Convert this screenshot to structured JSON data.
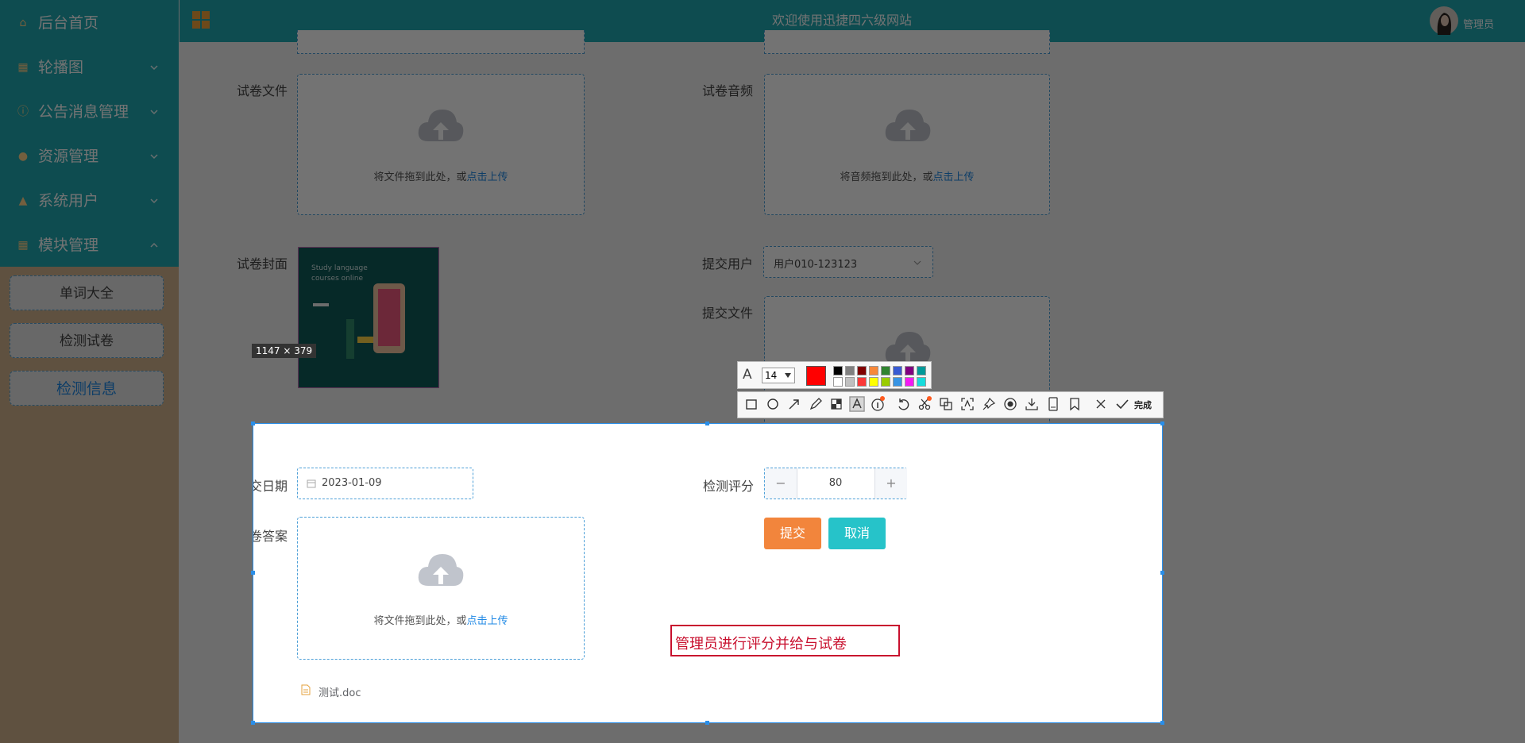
{
  "sidebar": {
    "menu": [
      {
        "label": "后台首页",
        "icon": "home-icon",
        "has_chevron": false
      },
      {
        "label": "轮播图",
        "icon": "image-icon",
        "has_chevron": true
      },
      {
        "label": "公告消息管理",
        "icon": "info-icon",
        "has_chevron": true
      },
      {
        "label": "资源管理",
        "icon": "bell-icon",
        "has_chevron": true
      },
      {
        "label": "系统用户",
        "icon": "user-icon",
        "has_chevron": true
      },
      {
        "label": "模块管理",
        "icon": "grid-icon",
        "has_chevron": true,
        "expanded": true
      }
    ],
    "submenu": [
      {
        "label": "单词大全"
      },
      {
        "label": "检测试卷"
      },
      {
        "label": "检测信息",
        "active": true
      }
    ]
  },
  "header": {
    "title": "欢迎使用迅捷四六级网站",
    "user_name": "管理员",
    "menu_icon": "apps-grid-icon"
  },
  "form": {
    "file_label": "试卷文件",
    "audio_label": "试卷音频",
    "file_hint_prefix": "将文件拖到此处，或",
    "audio_hint_prefix": "将音频拖到此处，或",
    "upload_link": "点击上传",
    "cover_label": "试卷封面",
    "cover_text_line1": "Study language",
    "cover_text_line2": "courses online",
    "submit_user_label": "提交用户",
    "submit_user_value": "用户010-123123",
    "submit_file_label": "提交文件",
    "submit_date_label": "提交日期",
    "submit_date_value": "2023-01-09",
    "score_label": "检测评分",
    "score_value": "80",
    "answer_label": "试卷答案",
    "answer_hint_prefix": "将文件拖到此处，或",
    "attachment_name": "测试.doc",
    "submit_button": "提交",
    "cancel_button": "取消"
  },
  "screenshot_tool": {
    "size_readout": "1147 × 379",
    "font_size": "14",
    "current_color": "#ff0000",
    "palette": [
      "#000000",
      "#808080",
      "#800000",
      "#f7883a",
      "#308430",
      "#385ad3",
      "#800080",
      "#009999",
      "#ffffff",
      "#c0c0c0",
      "#fb3838",
      "#ffff00",
      "#99cc00",
      "#3894e4",
      "#f31bf3",
      "#16dcdc"
    ],
    "tools": [
      "rectangle-icon",
      "ellipse-icon",
      "arrow-icon",
      "pen-icon",
      "mosaic-icon",
      "text-icon",
      "number-icon",
      "undo-icon",
      "scissors-icon",
      "copy-icon",
      "ocr-icon",
      "pin-icon",
      "record-icon",
      "save-icon",
      "long-screenshot-icon",
      "bookmark-icon",
      "close-icon",
      "check-icon"
    ],
    "done_label": "完成",
    "annotation_text": "管理员进行评分并给与试卷",
    "annotation_color": "#c8102e"
  }
}
